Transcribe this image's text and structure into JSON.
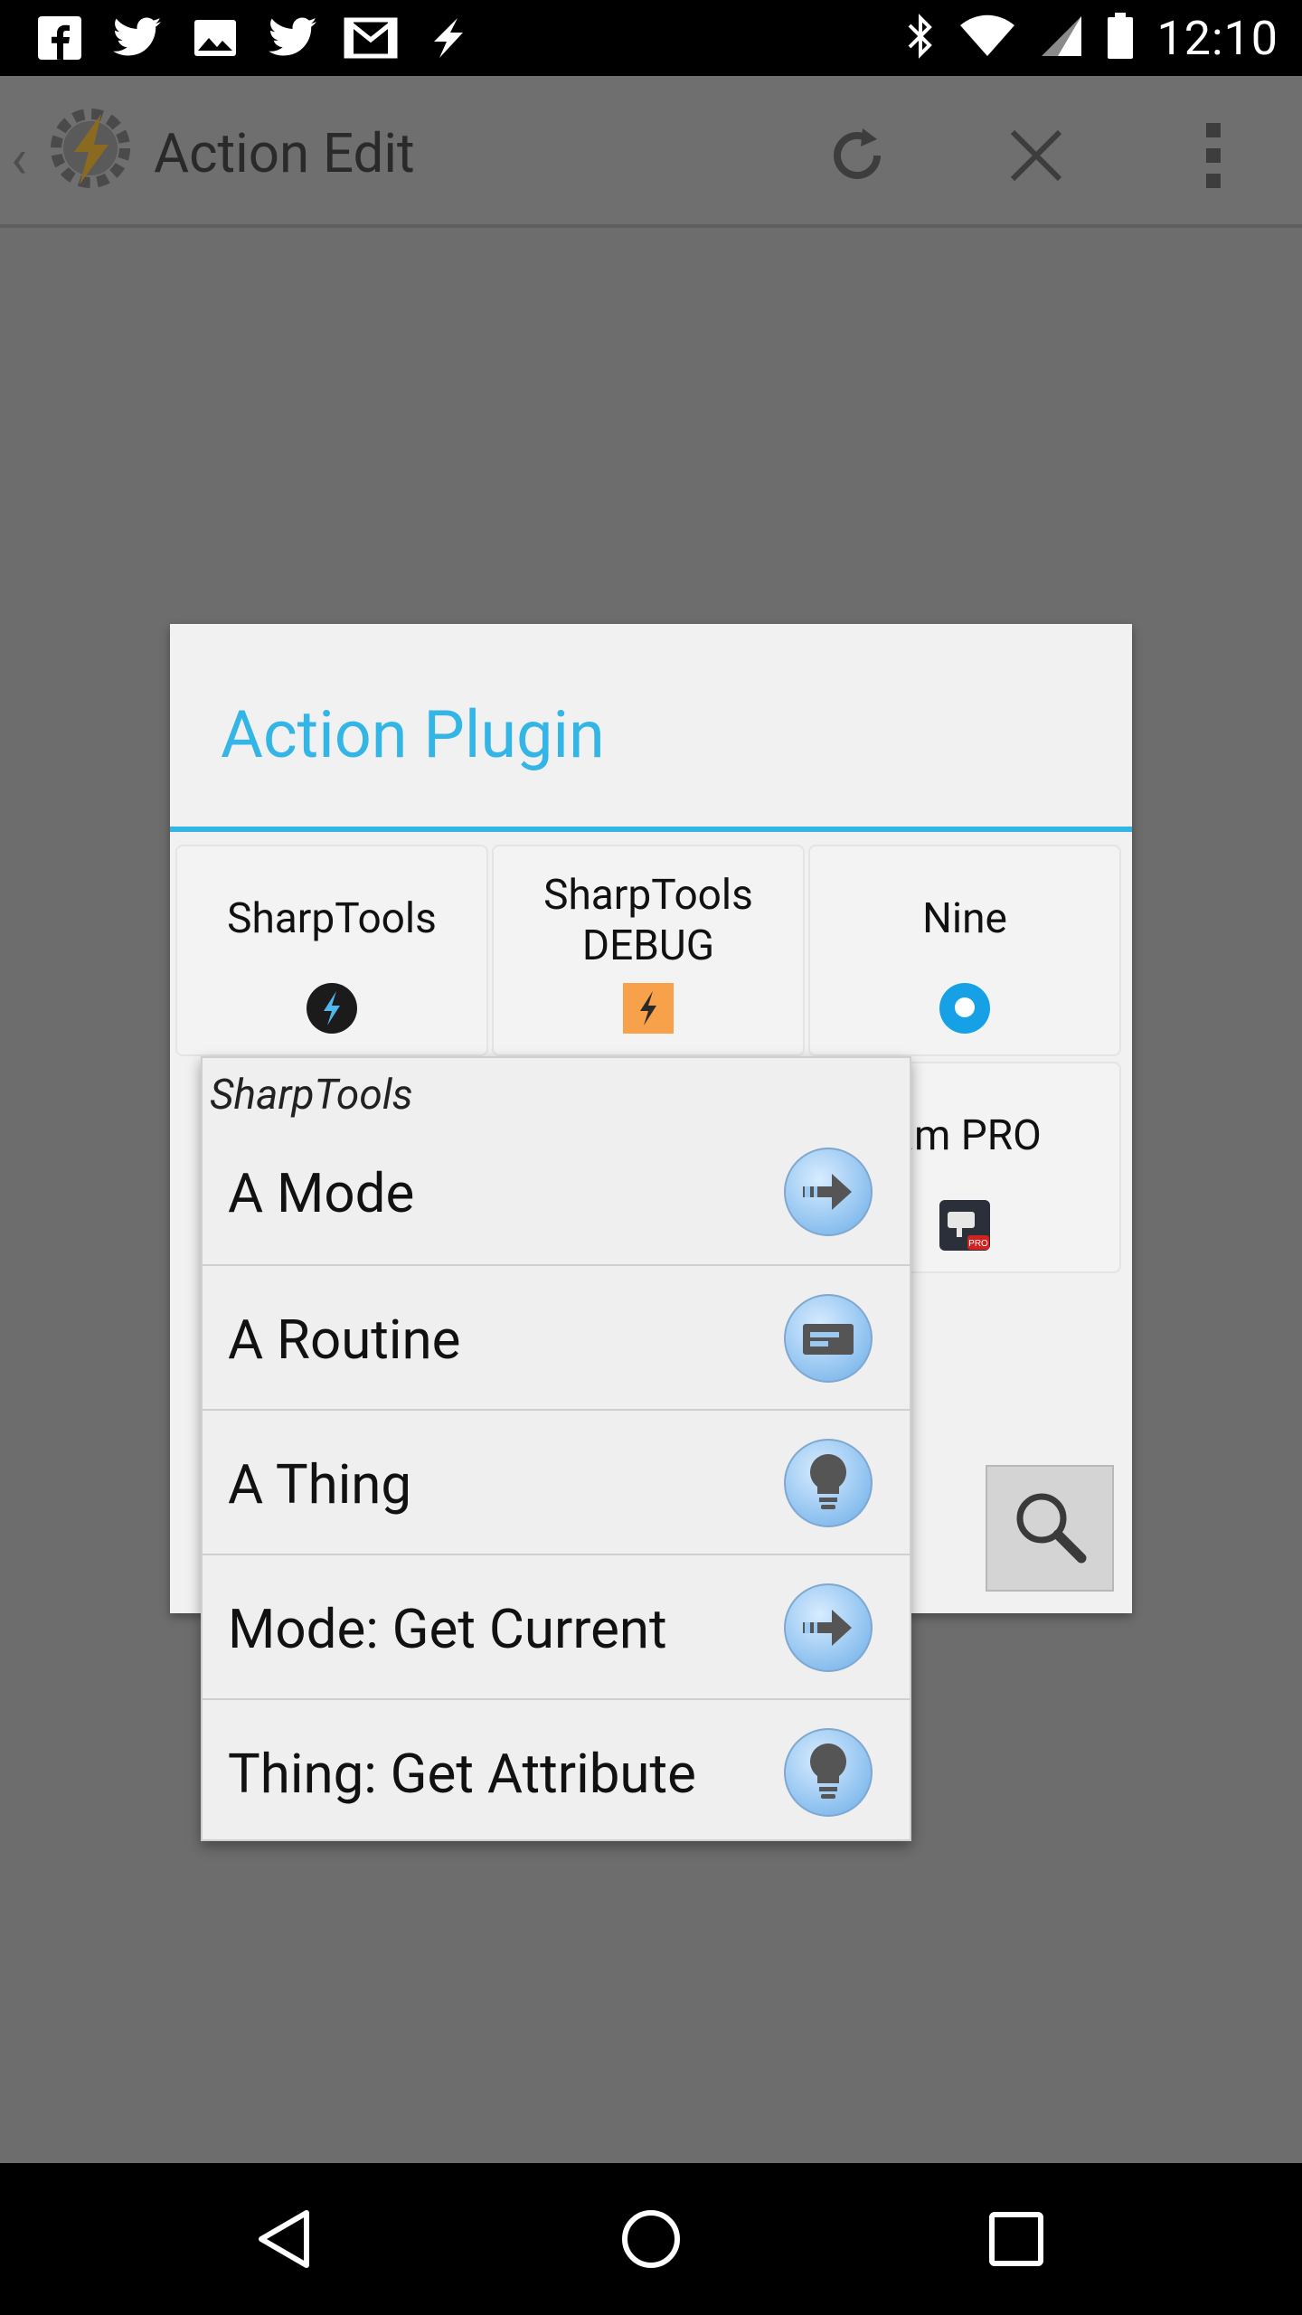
{
  "status_bar": {
    "time": "12:10",
    "notification_icons": [
      "facebook-icon",
      "twitter-icon",
      "image-icon",
      "twitter-icon",
      "gmail-icon",
      "bolt-icon"
    ],
    "system_icons": [
      "bluetooth-icon",
      "wifi-icon",
      "signal-icon",
      "battery-icon"
    ]
  },
  "action_bar": {
    "title": "Action Edit"
  },
  "dialog": {
    "title": "Action Plugin",
    "accent_color": "#33b5e5",
    "tiles": [
      {
        "label": "SharpTools",
        "icon": "sharptools-icon"
      },
      {
        "label": "SharpTools\nDEBUG",
        "icon": "sharptools-debug-icon"
      },
      {
        "label": "Nine",
        "icon": "nine-icon"
      },
      {
        "label": "Cam PRO",
        "icon": "cam-pro-icon"
      }
    ],
    "search_icon": "search-icon"
  },
  "popup_menu": {
    "header": "SharpTools",
    "items": [
      {
        "label": "A Mode",
        "icon": "arrow-icon"
      },
      {
        "label": "A Routine",
        "icon": "routine-icon"
      },
      {
        "label": "A Thing",
        "icon": "bulb-icon"
      },
      {
        "label": "Mode: Get Current",
        "icon": "arrow-icon"
      },
      {
        "label": "Thing: Get Attribute",
        "icon": "bulb-icon"
      }
    ]
  },
  "nav_bar": {
    "buttons": [
      "back-icon",
      "home-icon",
      "recents-icon"
    ]
  }
}
